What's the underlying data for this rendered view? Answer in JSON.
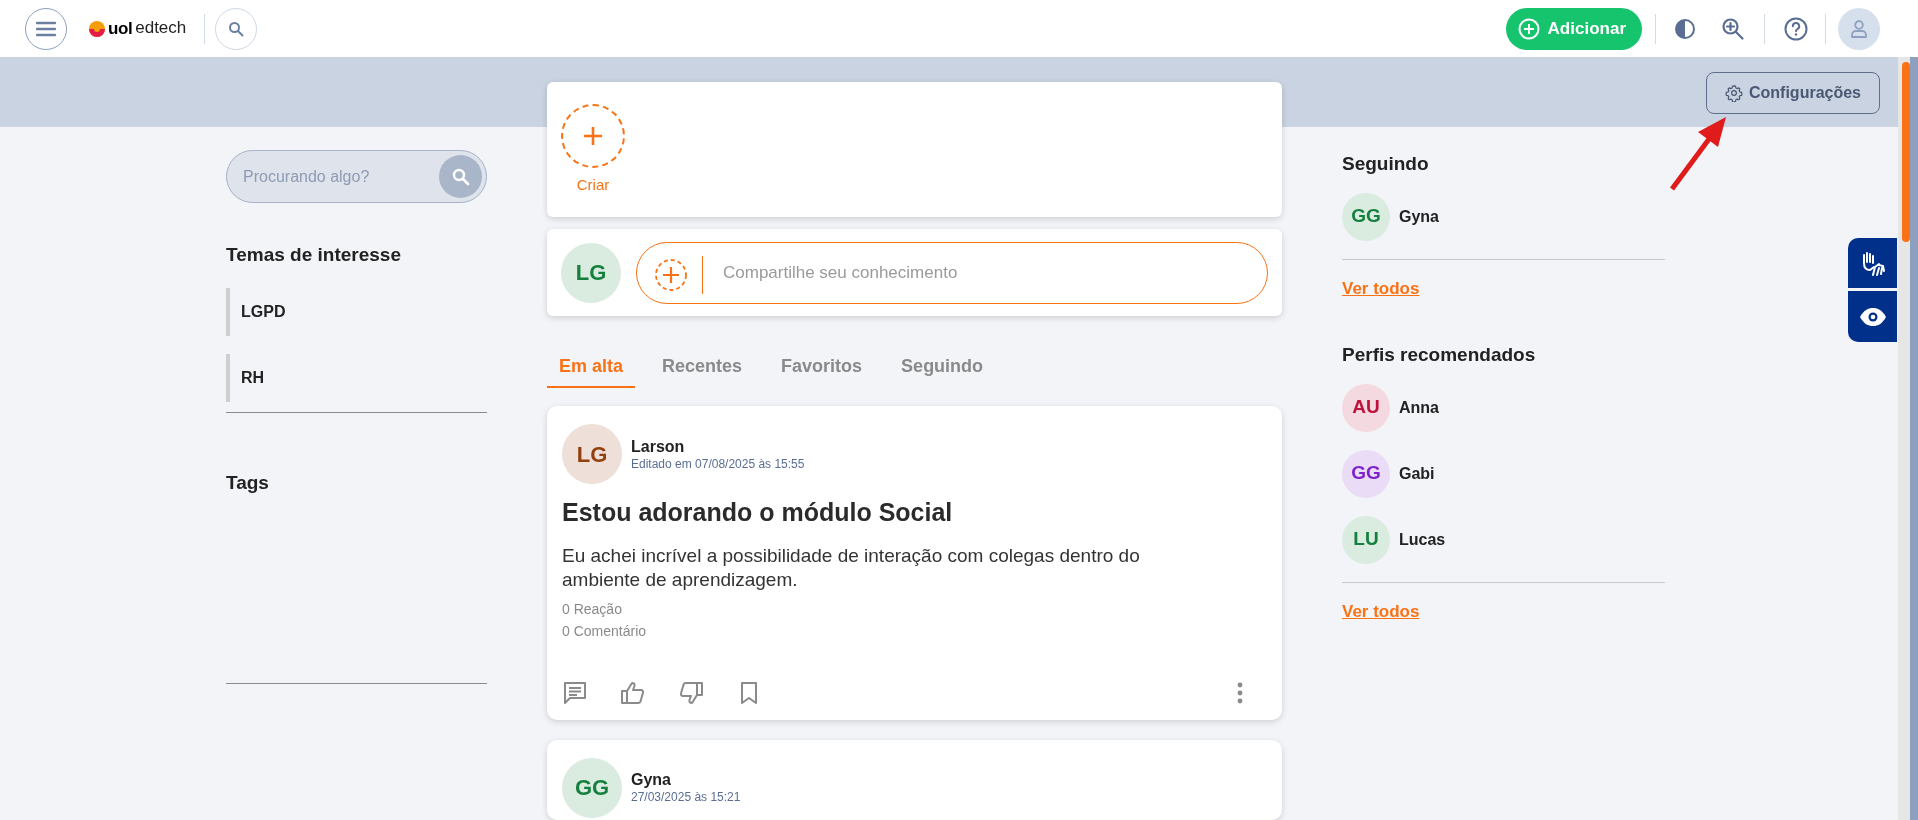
{
  "header": {
    "logo": {
      "brand": "uol",
      "product": "edtech"
    },
    "add_button": "Adicionar"
  },
  "banner": {
    "settings_button": "Configurações"
  },
  "left": {
    "search": {
      "placeholder": "Procurando algo?"
    },
    "topics_title": "Temas de interesse",
    "topics": [
      {
        "label": "LGPD"
      },
      {
        "label": "RH"
      }
    ],
    "tags_title": "Tags"
  },
  "create": {
    "label": "Criar"
  },
  "share": {
    "avatar": {
      "initials": "LG",
      "color": "#15803d"
    },
    "placeholder": "Compartilhe seu conhecimento"
  },
  "tabs": [
    {
      "label": "Em alta",
      "selected": true
    },
    {
      "label": "Recentes",
      "selected": false
    },
    {
      "label": "Favoritos",
      "selected": false
    },
    {
      "label": "Seguindo",
      "selected": false
    }
  ],
  "posts": [
    {
      "avatar": {
        "initials": "LG",
        "color": "#92400e"
      },
      "author": "Larson",
      "date": "Editado em 07/08/2025 às 15:55",
      "title": "Estou adorando o módulo Social",
      "body": "Eu achei incrível a possibilidade de interação com colegas dentro do ambiente de aprendizagem.",
      "reactions": "0 Reação",
      "comments": "0 Comentário"
    },
    {
      "avatar": {
        "initials": "GG",
        "color": "#15803d"
      },
      "author": "Gyna",
      "date": "27/03/2025 às 15:21"
    }
  ],
  "right": {
    "following_title": "Seguindo",
    "following": [
      {
        "initials": "GG",
        "name": "Gyna",
        "color": "#15803d"
      }
    ],
    "following_link": "Ver todos",
    "recommended_title": "Perfis recomendados",
    "recommended": [
      {
        "initials": "AU",
        "name": "Anna",
        "color": "#be123c"
      },
      {
        "initials": "GG",
        "name": "Gabi",
        "color": "#7e22ce"
      },
      {
        "initials": "LU",
        "name": "Lucas",
        "color": "#15803d"
      }
    ],
    "recommended_link": "Ver todos"
  }
}
